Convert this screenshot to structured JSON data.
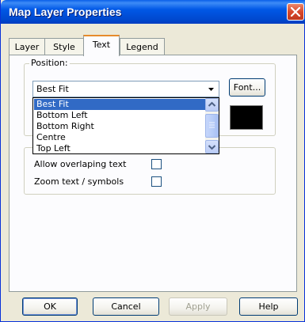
{
  "window": {
    "title": "Map Layer Properties"
  },
  "tabs": [
    {
      "label": "Layer"
    },
    {
      "label": "Style"
    },
    {
      "label": "Text",
      "active": true
    },
    {
      "label": "Legend"
    }
  ],
  "position_group": {
    "legend": "Position:",
    "combo_value": "Best Fit",
    "options": [
      "Best Fit",
      "Bottom Left",
      "Bottom Right",
      "Centre",
      "Top Left"
    ],
    "selected_option": "Best Fit"
  },
  "font_button": "Font...",
  "text_color": "#000000",
  "options": {
    "allow_overlap_label": "Allow overlaping text",
    "allow_overlap_checked": false,
    "zoom_text_label": "Zoom text / symbols",
    "zoom_text_checked": false
  },
  "footer": {
    "ok": "OK",
    "cancel": "Cancel",
    "apply": "Apply",
    "help": "Help"
  },
  "icons": {
    "close": "close-icon",
    "dropdown": "chevron-down-icon",
    "scroll_up": "arrow-up-icon",
    "scroll_down": "arrow-down-icon"
  }
}
